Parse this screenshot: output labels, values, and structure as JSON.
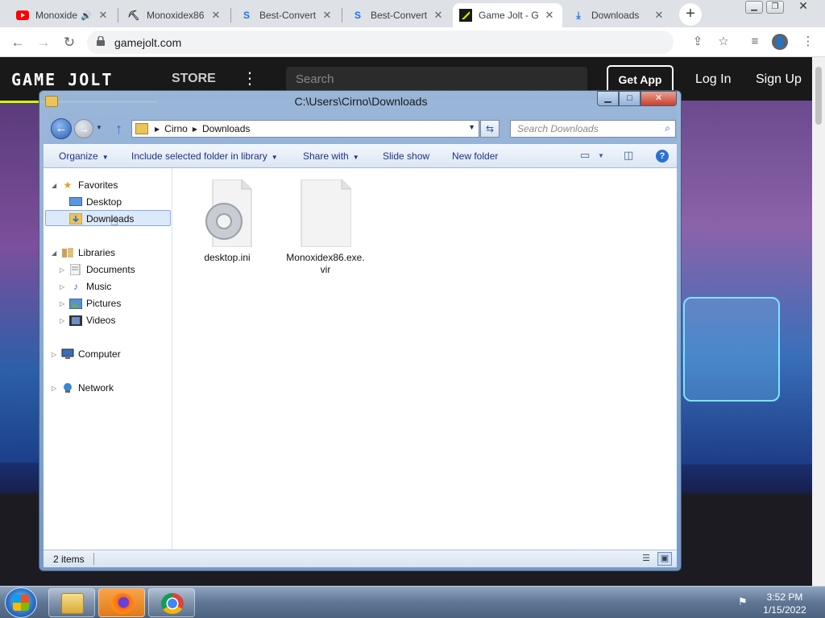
{
  "browser": {
    "tabs": [
      {
        "title": "Monoxide",
        "icon": "youtube-icon",
        "has_sound": true
      },
      {
        "title": "Monoxidex86",
        "icon": "monoxidex86-icon"
      },
      {
        "title": "Best-Converte",
        "icon": "best-converter-icon"
      },
      {
        "title": "Best-Converte",
        "icon": "best-converter-icon"
      },
      {
        "title": "Game Jolt - G",
        "icon": "gamejolt-icon",
        "active": true
      },
      {
        "title": "Downloads",
        "icon": "download-icon"
      }
    ],
    "url": "gamejolt.com"
  },
  "gamejolt": {
    "logo": "GAME JOLT",
    "store": "STORE",
    "search_placeholder": "Search",
    "get_app": "Get App",
    "login": "Log In",
    "signup": "Sign Up"
  },
  "explorer": {
    "title": "C:\\Users\\Cirno\\Downloads",
    "breadcrumb": [
      "Cirno",
      "Downloads"
    ],
    "search_placeholder": "Search Downloads",
    "commands": {
      "organize": "Organize",
      "include": "Include selected folder in library",
      "share": "Share with",
      "slideshow": "Slide show",
      "newfolder": "New folder"
    },
    "nav": {
      "favorites": "Favorites",
      "desktop": "Desktop",
      "downloads": "Downloads",
      "libraries": "Libraries",
      "documents": "Documents",
      "music": "Music",
      "pictures": "Pictures",
      "videos": "Videos",
      "computer": "Computer",
      "network": "Network"
    },
    "files": [
      {
        "name": "desktop.ini",
        "type": "settings-file-icon"
      },
      {
        "name": "Monoxidex86.exe.\nvir",
        "type": "blank-file-icon"
      }
    ],
    "status": "2 items"
  },
  "taskbar": {
    "time": "3:52 PM",
    "date": "1/15/2022"
  }
}
